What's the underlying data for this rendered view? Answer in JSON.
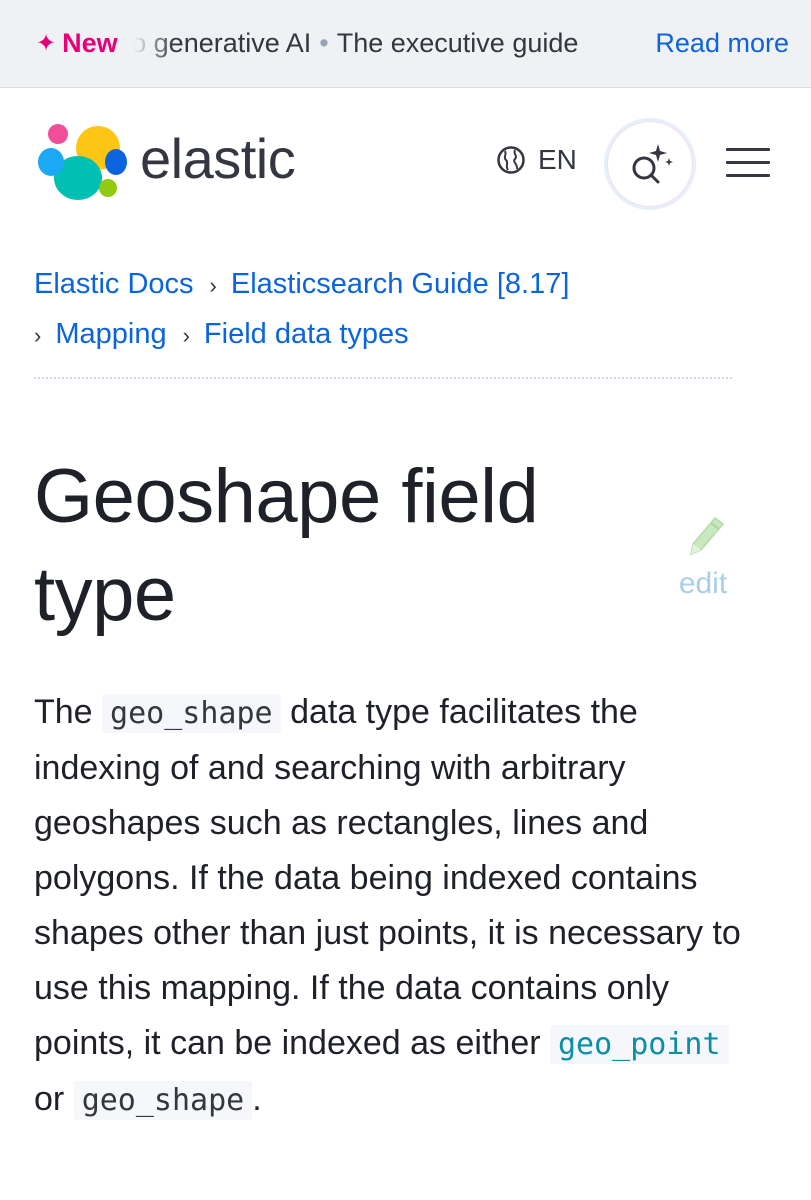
{
  "banner": {
    "new_label": "New",
    "text_part1": "to generative AI",
    "text_part2": "The executive guide",
    "read_more": "Read more"
  },
  "header": {
    "brand": "elastic",
    "language": "EN"
  },
  "breadcrumb": {
    "items": [
      "Elastic Docs",
      "Elasticsearch Guide [8.17]",
      "Mapping",
      "Field data types"
    ]
  },
  "page": {
    "title": "Geoshape field type",
    "edit_label": "edit"
  },
  "content": {
    "p1_before": "The",
    "code_geo_shape": "geo_shape",
    "p1_mid": "data type facilitates the indexing of and searching with arbitrary geoshapes such as rectangles, lines and polygons. If the data being indexed contains shapes other than just points, it is necessary to use this mapping. If the data contains only points, it can be indexed as either",
    "code_geo_point": "geo_point",
    "p1_or": "or",
    "code_geo_shape_2": "geo_shape",
    "p1_end": "."
  },
  "colors": {
    "accent_pink": "#e6007a",
    "link_blue": "#0b64dd",
    "text_dark": "#1f2129"
  },
  "icons": [
    "sparkle-icon",
    "elastic-logo",
    "globe-icon",
    "ai-search-icon",
    "hamburger-menu-icon",
    "pencil-icon"
  ]
}
